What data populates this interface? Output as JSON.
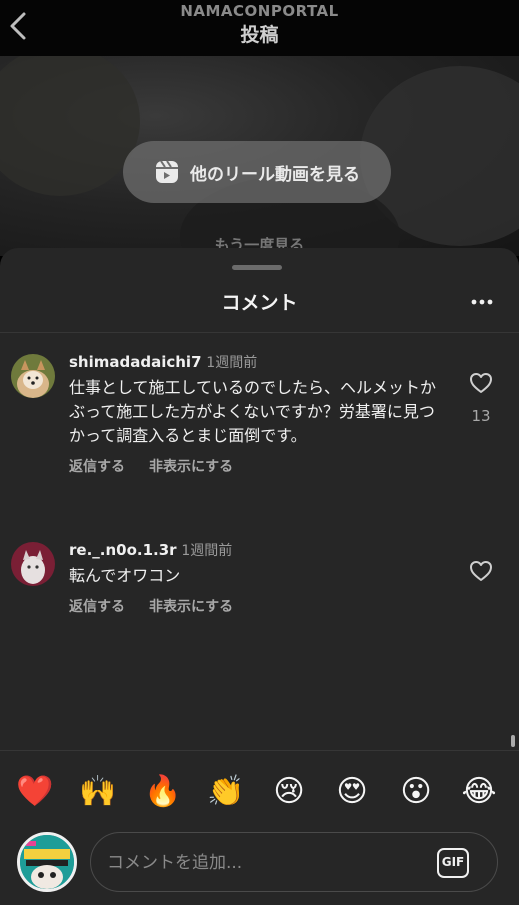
{
  "header": {
    "account": "NAMACONPORTAL",
    "title": "投稿"
  },
  "video": {
    "reel_button_label": "他のリール動画を見る",
    "replay_label": "もう一度見る"
  },
  "sheet": {
    "title": "コメント"
  },
  "comments": [
    {
      "username": "shimadadaichi7",
      "time": "1週間前",
      "text": "仕事として施工しているのでしたら、ヘルメットかぶって施工した方がよくないですか？労基署に見つかって調査入るとまじ面倒です。",
      "reply_label": "返信する",
      "hide_label": "非表示にする",
      "likes": "13"
    },
    {
      "username": "re._.n0o.1.3r",
      "time": "1週間前",
      "text": "転んでオワコン",
      "reply_label": "返信する",
      "hide_label": "非表示にする",
      "likes": ""
    }
  ],
  "emoji_reactions": [
    "❤️",
    "🙌",
    "🔥",
    "👏",
    "😢",
    "😍",
    "😮",
    "😂"
  ],
  "composer": {
    "placeholder": "コメントを追加...",
    "gif_label": "GIF"
  },
  "colors": {
    "sheet_bg": "#262626",
    "text": "#f5f5f5",
    "muted": "#a8a8a8"
  }
}
